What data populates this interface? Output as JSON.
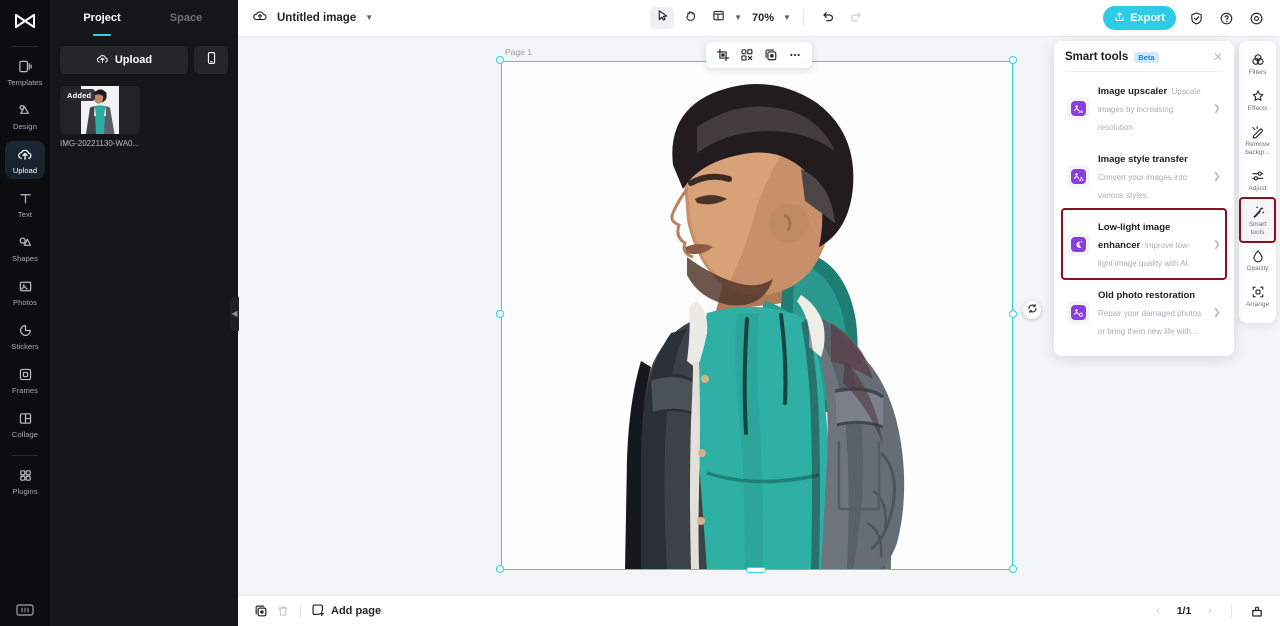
{
  "left_rail": {
    "logo": "app-logo",
    "items": [
      {
        "label": "Templates",
        "icon": "templates-icon",
        "active": false
      },
      {
        "label": "Design",
        "icon": "design-icon",
        "active": false
      },
      {
        "label": "Upload",
        "icon": "upload-cloud-icon",
        "active": true
      },
      {
        "label": "Text",
        "icon": "text-icon",
        "active": false
      },
      {
        "label": "Shapes",
        "icon": "shapes-icon",
        "active": false
      },
      {
        "label": "Photos",
        "icon": "photos-icon",
        "active": false
      },
      {
        "label": "Stickers",
        "icon": "stickers-icon",
        "active": false
      },
      {
        "label": "Frames",
        "icon": "frames-icon",
        "active": false
      },
      {
        "label": "Collage",
        "icon": "collage-icon",
        "active": false
      },
      {
        "label": "Plugins",
        "icon": "plugins-icon",
        "active": false
      }
    ],
    "bottom_icon": "keyboard-shortcuts-icon"
  },
  "panel": {
    "tabs": [
      {
        "label": "Project",
        "active": true
      },
      {
        "label": "Space",
        "active": false
      }
    ],
    "upload_label": "Upload",
    "upload_icon": "upload-cloud-icon",
    "phone_icon": "mobile-upload-icon",
    "assets": [
      {
        "name": "IMG-20221130-WA0...",
        "badge": "Added"
      }
    ],
    "collapse_icon": "collapse-panel-icon"
  },
  "topbar": {
    "cloud_icon": "cloud-save-icon",
    "title": "Untitled image",
    "title_caret": "chevron-down-icon",
    "tools": [
      {
        "name": "select-tool",
        "icon": "cursor-arrow-icon",
        "selected": true
      },
      {
        "name": "hand-tool",
        "icon": "hand-icon",
        "selected": false
      },
      {
        "name": "layout-tool",
        "icon": "layout-icon",
        "selected": false
      }
    ],
    "layout_caret": "chevron-down-icon",
    "zoom": "70%",
    "zoom_caret": "chevron-down-icon",
    "undo_icon": "undo-icon",
    "redo_icon": "redo-icon",
    "export_label": "Export",
    "export_icon": "export-icon",
    "export_color": "#2dcbe6",
    "shield_icon": "shield-icon",
    "help_icon": "help-circle-icon",
    "settings_icon": "settings-gear-icon"
  },
  "canvas": {
    "page_label": "Page 1",
    "float_tools": [
      {
        "name": "crop-button",
        "icon": "crop-icon"
      },
      {
        "name": "remove-background-button",
        "icon": "cutout-icon"
      },
      {
        "name": "duplicate-button",
        "icon": "duplicate-icon"
      },
      {
        "name": "more-options-button",
        "icon": "more-horizontal-icon"
      }
    ],
    "side_tools": [
      {
        "name": "layers-button",
        "icon": "layers-icon"
      },
      {
        "name": "canvas-more-button",
        "icon": "more-horizontal-icon"
      }
    ],
    "selection_color": "#2ad4e0",
    "rotate_icon": "rotate-icon"
  },
  "bottombar": {
    "pages_icon": "pages-icon",
    "delete_icon": "trash-icon",
    "add_page_label": "Add page",
    "add_page_icon": "add-page-icon",
    "page_indicator": "1/1",
    "prev_icon": "chevron-left-icon",
    "next_icon": "chevron-right-icon",
    "timeline_icon": "export-panel-icon"
  },
  "smart_tools": {
    "title": "Smart tools",
    "badge": "Beta",
    "badge_color": "#cfe9ff",
    "close_icon": "close-icon",
    "highlight_color": "#8b1122",
    "items": [
      {
        "name": "Image upscaler",
        "desc": "Upscale images by increasing resolution.",
        "icon": "image-upscaler-icon",
        "glyph": "4K",
        "highlighted": false
      },
      {
        "name": "Image style transfer",
        "desc": "Convert your images into various styles.",
        "icon": "style-transfer-icon",
        "glyph": "",
        "highlighted": false
      },
      {
        "name": "Low-light image enhancer",
        "desc": "Improve low-light image quality with AI.",
        "icon": "low-light-enhancer-icon",
        "glyph": "",
        "highlighted": true
      },
      {
        "name": "Old photo restoration",
        "desc": "Repair your damaged photos or bring them new life with...",
        "icon": "photo-restoration-icon",
        "glyph": "",
        "highlighted": false
      }
    ]
  },
  "right_rail": {
    "items": [
      {
        "label": "Filters",
        "icon": "filters-icon",
        "active": false
      },
      {
        "label": "Effects",
        "icon": "effects-icon",
        "active": false
      },
      {
        "label": "Remove backgr...",
        "icon": "remove-background-icon",
        "active": false
      },
      {
        "label": "Adjust",
        "icon": "adjust-sliders-icon",
        "active": false
      },
      {
        "label": "Smart tools",
        "icon": "smart-tools-wand-icon",
        "active": true
      },
      {
        "label": "Opacity",
        "icon": "opacity-drop-icon",
        "active": false
      },
      {
        "label": "Arrange",
        "icon": "arrange-icon",
        "active": false
      }
    ]
  }
}
